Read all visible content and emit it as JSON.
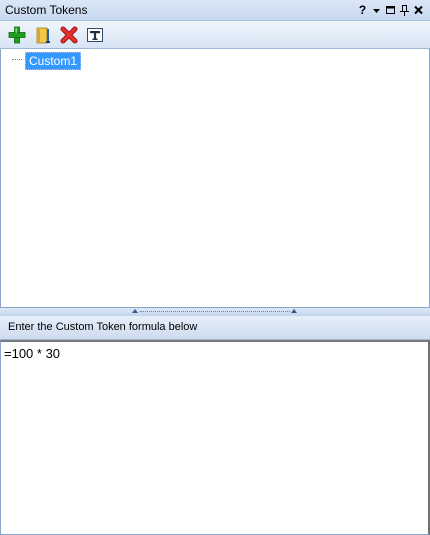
{
  "panel": {
    "title": "Custom Tokens",
    "controls": {
      "help": "?",
      "dropdown": "▾",
      "maximize": "□",
      "pin": "⊥",
      "close": "✕"
    }
  },
  "toolbar": {
    "buttons": [
      {
        "icon": "add-icon",
        "color": "#1e9e1e"
      },
      {
        "icon": "rename-icon",
        "color": "#d6a52a"
      },
      {
        "icon": "delete-icon",
        "color": "#d42020"
      },
      {
        "icon": "token-text-icon",
        "color": "#334a6a"
      }
    ]
  },
  "tree": {
    "nodes": [
      {
        "label": "Custom1",
        "selected": true
      }
    ]
  },
  "formula": {
    "label": "Enter the Custom Token formula below",
    "value": "=100 * 30"
  },
  "colors": {
    "selection": "#3399ff",
    "header": "#c7d8f0"
  }
}
